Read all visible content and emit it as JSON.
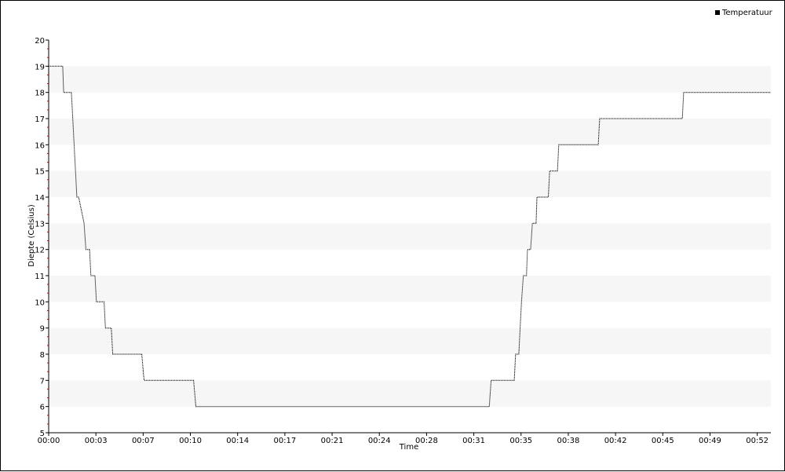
{
  "chart_data": {
    "type": "line",
    "title": "",
    "xlabel": "Time",
    "ylabel": "Diepte (Celsius)",
    "xlim_seconds": [
      0,
      3180
    ],
    "ylim": [
      5,
      20
    ],
    "x_tick_labels": [
      "00:00",
      "00:03",
      "00:07",
      "00:10",
      "00:14",
      "00:17",
      "00:21",
      "00:24",
      "00:28",
      "00:31",
      "00:35",
      "00:38",
      "00:42",
      "00:45",
      "00:49",
      "00:52"
    ],
    "x_tick_seconds": [
      0,
      208,
      416,
      624,
      832,
      1040,
      1248,
      1456,
      1664,
      1872,
      2080,
      2288,
      2496,
      2704,
      2912,
      3120
    ],
    "y_ticks": [
      5,
      6,
      7,
      8,
      9,
      10,
      11,
      12,
      13,
      14,
      15,
      16,
      17,
      18,
      19,
      20
    ],
    "grid": "alternating horizontal bands",
    "legend": {
      "position": "top-right",
      "entries": [
        "Temperatuur"
      ]
    },
    "colors": {
      "line": "#000000",
      "band": "#f6f6f6",
      "minor_tick": "#cc0000"
    },
    "series": [
      {
        "name": "Temperatuur",
        "x_seconds": [
          0,
          62,
          66,
          100,
          106,
          124,
          132,
          156,
          164,
          180,
          186,
          204,
          210,
          244,
          250,
          276,
          282,
          318,
          332,
          410,
          420,
          638,
          648,
          1940,
          1948,
          2050,
          2056,
          2070,
          2076,
          2082,
          2090,
          2104,
          2108,
          2122,
          2130,
          2146,
          2150,
          2170,
          2180,
          2200,
          2206,
          2240,
          2246,
          2262,
          2270,
          2310,
          2316,
          2420,
          2426,
          2790,
          2796,
          3180
        ],
        "values": [
          19,
          19,
          18,
          18,
          17,
          14,
          14,
          13,
          12,
          12,
          11,
          11,
          10,
          10,
          9,
          9,
          8,
          8,
          8,
          8,
          7,
          7,
          6,
          6,
          7,
          7,
          8,
          8,
          9,
          10,
          11,
          11,
          12,
          12,
          13,
          13,
          14,
          14,
          14,
          14,
          15,
          15,
          16,
          16,
          16,
          16,
          16,
          16,
          17,
          17,
          18,
          18
        ]
      }
    ]
  }
}
